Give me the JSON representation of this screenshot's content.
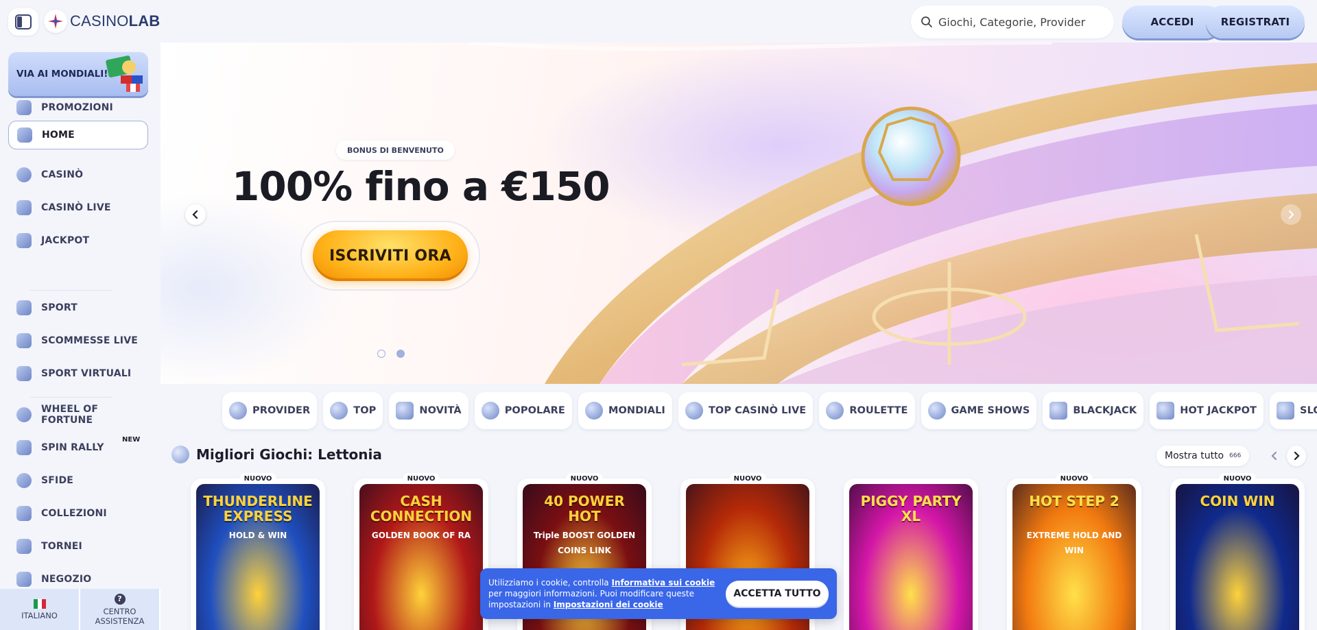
{
  "header": {
    "logo_prefix": "CASINO",
    "logo_suffix": "LAB",
    "search_placeholder": "Giochi, Categorie, Provider",
    "login_label": "ACCEDI",
    "register_label": "REGISTRATI"
  },
  "sidebar": {
    "promo_banner": "VIA AI MONDIALI!",
    "items": [
      {
        "label": "PROMOZIONI",
        "icon": "megaphone-icon"
      },
      {
        "label": "HOME",
        "icon": "home-icon",
        "active": true
      },
      {
        "label": "CASINÒ",
        "icon": "chip-icon"
      },
      {
        "label": "CASINÒ LIVE",
        "icon": "live-icon"
      },
      {
        "label": "JACKPOT",
        "icon": "jackpot-icon"
      },
      {
        "label": "SPORT",
        "icon": "sport-icon"
      },
      {
        "label": "SCOMMESSE LIVE",
        "icon": "live-bet-icon"
      },
      {
        "label": "SPORT VIRTUALI",
        "icon": "virtual-sport-icon"
      },
      {
        "label": "WHEEL OF FORTUNE",
        "icon": "wheel-icon"
      },
      {
        "label": "SPIN RALLY",
        "icon": "flag-icon",
        "badge": "NEW"
      },
      {
        "label": "SFIDE",
        "icon": "gear-icon"
      },
      {
        "label": "COLLEZIONI",
        "icon": "collection-icon"
      },
      {
        "label": "TORNEI",
        "icon": "trophy-icon"
      },
      {
        "label": "NEGOZIO",
        "icon": "cart-icon"
      }
    ],
    "footer": {
      "language": "ITALIANO",
      "help": "CENTRO ASSISTENZA",
      "help_icon_glyph": "?"
    }
  },
  "hero": {
    "tag": "BONUS DI BENVENUTO",
    "title": "100% fino a €150",
    "cta": "ISCRIVITI ORA",
    "slides": 2,
    "active_slide": 2
  },
  "categories": [
    "PROVIDER",
    "TOP",
    "NOVITÀ",
    "POPOLARE",
    "MONDIALI",
    "TOP CASINÒ LIVE",
    "ROULETTE",
    "GAME SHOWS",
    "BLACKJACK",
    "HOT JACKPOT",
    "SLOT"
  ],
  "section": {
    "title": "Migliori Giochi: Lettonia",
    "show_all": "Mostra tutto",
    "count": "666"
  },
  "games": [
    {
      "badge": "NUOVO",
      "name": "THUNDERLINE EXPRESS",
      "sub": "HOLD & WIN",
      "bg": "#1f4fbf",
      "accent": "#ffd23a"
    },
    {
      "badge": "NUOVO",
      "name": "CASH CONNECTION",
      "sub": "GOLDEN BOOK OF RA",
      "bg": "#b01818",
      "accent": "#ffd23a"
    },
    {
      "badge": "NUOVO",
      "name": "40 POWER HOT",
      "sub": "Triple BOOST GOLDEN COINS LINK",
      "bg": "#7a0f12",
      "accent": "#ffd23a"
    },
    {
      "badge": "NUOVO",
      "name": "",
      "sub": "",
      "bg": "#b52a08",
      "accent": "#ffb21a"
    },
    {
      "badge": "",
      "name": "PIGGY PARTY XL",
      "sub": "",
      "bg": "#d316a8",
      "accent": "#ffe04a"
    },
    {
      "badge": "NUOVO",
      "name": "HOT STEP 2",
      "sub": "EXTREME HOLD AND WIN",
      "bg": "#f27a10",
      "accent": "#ffe04a"
    },
    {
      "badge": "NUOVO",
      "name": "COIN WIN",
      "sub": "",
      "bg": "#102a8c",
      "accent": "#ffd23a"
    }
  ],
  "cookie": {
    "text1": "Utilizziamo i cookie, controlla ",
    "link1": "Informativa sui cookie",
    "text2": " per maggiori informazioni. Puoi modificare queste impostazioni in ",
    "link2": "Impostazioni dei cookie",
    "button": "ACCETTA TUTTO"
  }
}
